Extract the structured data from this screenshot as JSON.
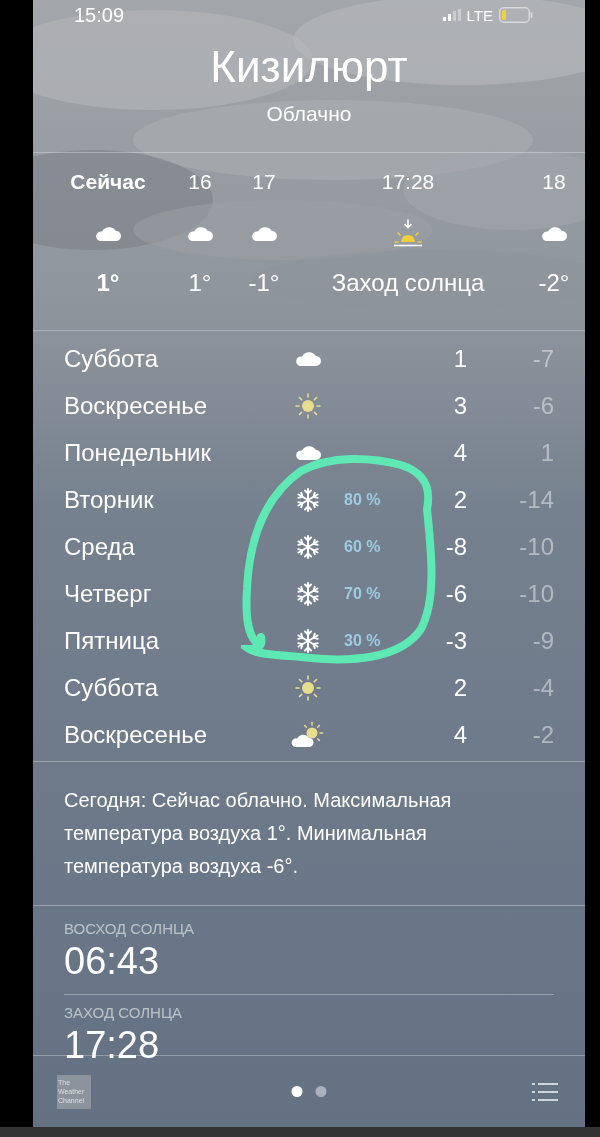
{
  "status_bar": {
    "time": "15:09",
    "network": "LTE"
  },
  "location": {
    "city": "Кизилюрт",
    "condition": "Облачно"
  },
  "hourly": [
    {
      "time": "Сейчас",
      "kind": "cloud",
      "temp": "1°",
      "now": true
    },
    {
      "time": "16",
      "kind": "cloud",
      "temp": "1°",
      "now": false
    },
    {
      "time": "17",
      "kind": "cloud",
      "temp": "-1°",
      "now": false
    },
    {
      "time": "17:28",
      "kind": "sunset",
      "temp": "Заход солнца",
      "now": false
    },
    {
      "time": "18",
      "kind": "cloud",
      "temp": "-2°",
      "now": false
    }
  ],
  "daily": [
    {
      "day": "Суббота",
      "kind": "cloud",
      "high": "1",
      "low": "-7"
    },
    {
      "day": "Воскресенье",
      "kind": "sun",
      "high": "3",
      "low": "-6"
    },
    {
      "day": "Понедельник",
      "kind": "cloud",
      "high": "4",
      "low": "1"
    },
    {
      "day": "Вторник",
      "kind": "snow",
      "precipitation": "80 %",
      "high": "2",
      "low": "-14"
    },
    {
      "day": "Среда",
      "kind": "snow",
      "precipitation": "60 %",
      "high": "-8",
      "low": "-10"
    },
    {
      "day": "Четверг",
      "kind": "snow",
      "precipitation": "70 %",
      "high": "-6",
      "low": "-10"
    },
    {
      "day": "Пятница",
      "kind": "snow",
      "precipitation": "30 %",
      "high": "-3",
      "low": "-9"
    },
    {
      "day": "Суббота",
      "kind": "sun",
      "high": "2",
      "low": "-4"
    },
    {
      "day": "Воскресенье",
      "kind": "partly",
      "high": "4",
      "low": "-2"
    }
  ],
  "summary": "Сегодня: Сейчас облачно. Максимальная температура воздуха 1°. Минимальная температура воздуха -6°.",
  "details": [
    {
      "label": "ВОСХОД СОЛНЦА",
      "value": "06:43"
    },
    {
      "label": "ЗАХОД СОЛНЦА",
      "value": "17:28"
    }
  ],
  "toolbar": {
    "logo": "The Weather Channel",
    "pages": [
      {
        "selected": true
      },
      {
        "selected": false
      }
    ]
  }
}
